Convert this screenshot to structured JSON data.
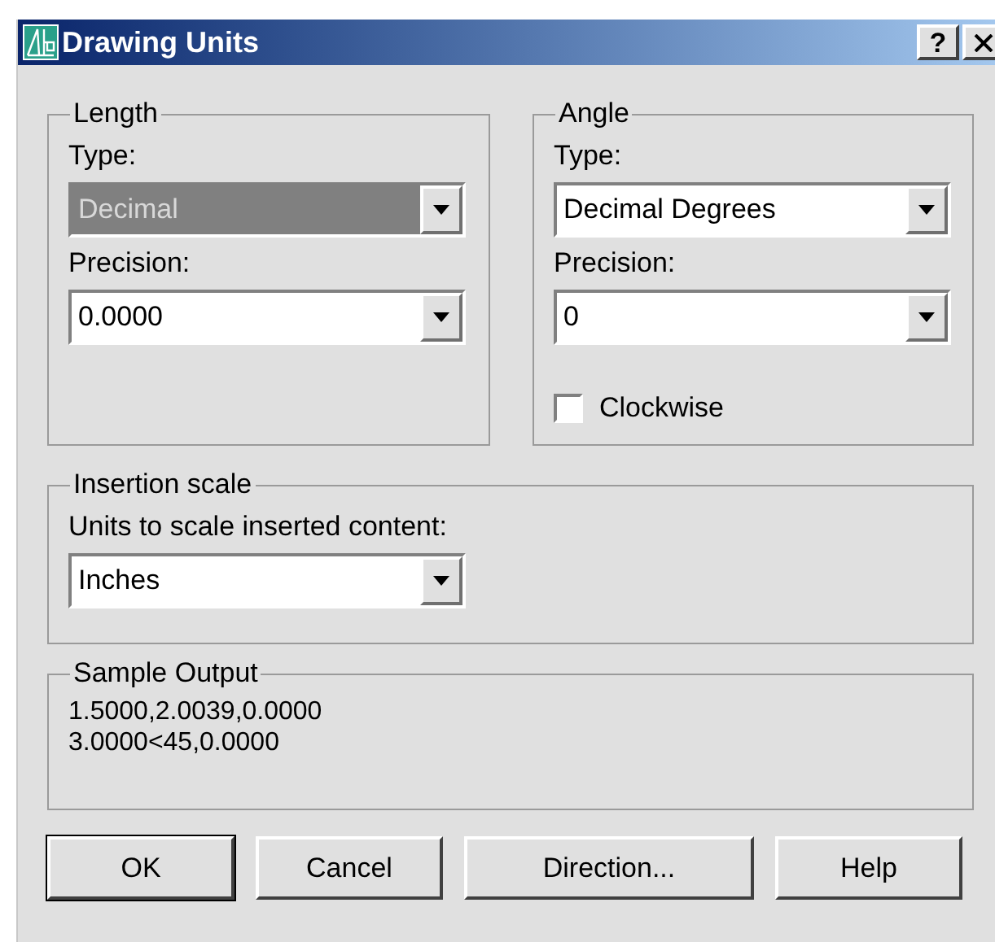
{
  "window": {
    "title": "Drawing Units",
    "help_button": "?"
  },
  "length": {
    "title": "Length",
    "type_label": "Type:",
    "type": {
      "value": "Decimal",
      "disabled": true
    },
    "precision_label": "Precision:",
    "precision": {
      "value": "0.0000",
      "disabled": false
    }
  },
  "angle": {
    "title": "Angle",
    "type_label": "Type:",
    "type": {
      "value": "Decimal Degrees",
      "disabled": false
    },
    "precision_label": "Precision:",
    "precision": {
      "value": "0",
      "disabled": false
    },
    "clockwise": {
      "label": "Clockwise",
      "checked": false
    }
  },
  "insertion_scale": {
    "title": "Insertion scale",
    "label": "Units to scale inserted content:",
    "units": {
      "value": "Inches",
      "disabled": false
    }
  },
  "sample_output": {
    "title": "Sample Output",
    "lines": [
      "1.5000,2.0039,0.0000",
      "3.0000<45,0.0000"
    ]
  },
  "buttons": [
    {
      "label": "OK",
      "default": true
    },
    {
      "label": "Cancel",
      "default": false
    },
    {
      "label": "Direction...",
      "default": false
    },
    {
      "label": "Help",
      "default": false
    }
  ]
}
